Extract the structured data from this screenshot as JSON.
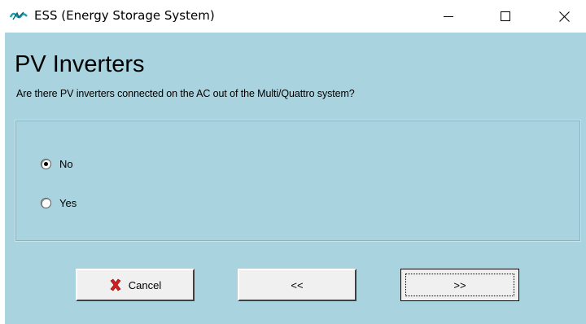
{
  "window": {
    "title": "ESS (Energy Storage System)",
    "icon": "victron-ess-icon"
  },
  "header": {
    "title": "PV Inverters",
    "subtitle": "Are there PV inverters connected on the AC out of the Multi/Quattro system?"
  },
  "options": [
    {
      "label": "No",
      "selected": true
    },
    {
      "label": "Yes",
      "selected": false
    }
  ],
  "buttons": {
    "cancel": "Cancel",
    "back": "<<",
    "next": ">>"
  },
  "colors": {
    "background": "#a9d3df",
    "cancel_icon": "#d42020"
  }
}
